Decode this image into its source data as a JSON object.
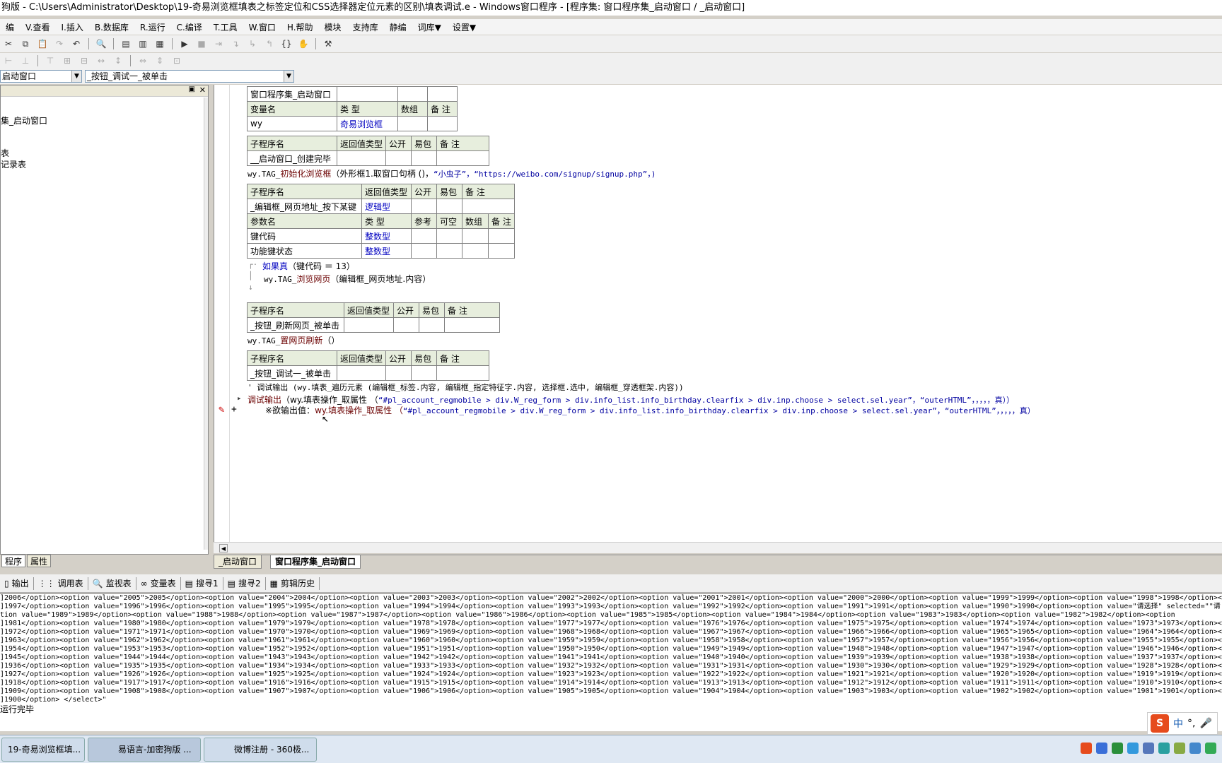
{
  "window": {
    "title": "狗版 - C:\\Users\\Administrator\\Desktop\\19-奇易浏览框填表之标签定位和CSS选择器定位元素的区别\\填表调试.e - Windows窗口程序 - [程序集: 窗口程序集_启动窗口 / _启动窗口]"
  },
  "menu": [
    "编",
    "V.查看",
    "I.插入",
    "B.数据库",
    "R.运行",
    "C.编译",
    "T.工具",
    "W.窗口",
    "H.帮助",
    "模块",
    "支持库",
    "静编",
    "词库▼",
    "设置▼"
  ],
  "selectors": {
    "left": "启动窗口",
    "right": "_按钮_调试一_被单击"
  },
  "tree": {
    "items": [
      "集_启动窗口",
      "",
      "表",
      "记录表"
    ]
  },
  "left_tabs": [
    "程序",
    "属性"
  ],
  "editor_tabs": [
    "_启动窗口",
    "窗口程序集_启动窗口"
  ],
  "code": {
    "t1": {
      "head": [
        "窗口程序集_启动窗口",
        "",
        ""
      ],
      "cols": [
        "变量名",
        "类 型",
        "数组",
        "备 注"
      ],
      "row": [
        "wy",
        "奇易浏览框",
        "",
        ""
      ]
    },
    "t2": {
      "cols": [
        "子程序名",
        "返回值类型",
        "公开",
        "易包",
        "备 注"
      ],
      "row": [
        "__启动窗口_创建完毕",
        "",
        "",
        "",
        ""
      ]
    },
    "line1": {
      "a": "wy.TAG_",
      "b": "初始化浏览框",
      "c": "（外形框1.取窗口句柄 ()，",
      "d": "“小虫子”，“https://weibo.com/signup/signup.php”，)"
    },
    "t3": {
      "cols": [
        "子程序名",
        "返回值类型",
        "公开",
        "易包",
        "备 注"
      ],
      "row": [
        "_编辑框_网页地址_按下某键",
        "逻辑型",
        "",
        "",
        ""
      ],
      "pcols": [
        "参数名",
        "类 型",
        "参考",
        "可空",
        "数组",
        "备 注"
      ],
      "p1": [
        "键代码",
        "整数型",
        "",
        "",
        "",
        ""
      ],
      "p2": [
        "功能键状态",
        "整数型",
        "",
        "",
        "",
        ""
      ]
    },
    "line2": {
      "kw": "如果真",
      "rest": "（键代码 ＝ 13）"
    },
    "line3": {
      "a": "wy.TAG_",
      "b": "浏览网页",
      "c": "（编辑框_网页地址.内容）"
    },
    "t4": {
      "cols": [
        "子程序名",
        "返回值类型",
        "公开",
        "易包",
        "备 注"
      ],
      "row": [
        "_按钮_刷新网页_被单击",
        "",
        "",
        "",
        ""
      ]
    },
    "line4": {
      "a": "wy.TAG_",
      "b": "置网页刷新",
      "c": "（）"
    },
    "t5": {
      "cols": [
        "子程序名",
        "返回值类型",
        "公开",
        "易包",
        "备 注"
      ],
      "row": [
        "_按钮_调试一_被单击",
        "",
        "",
        "",
        ""
      ]
    },
    "line5": "' 调试输出 (wy.填表_遍历元素 (编辑框_标签.内容, 编辑框_指定特征字.内容, 选择框.选中, 编辑框_穿透框架.内容))",
    "line6": {
      "a": "调试输出",
      "b": "（wy.填表操作_取属性 （",
      "c": "“#pl_account_regmobile > div.W_reg_form > div.info_list.info_birthday.clearfix > div.inp.choose > select.sel.year”，“outerHTML”，，，，，真））"
    },
    "line7": {
      "a": "※欲输出值：",
      "b": "wy.填表操作_取属性 （",
      "c": "“#pl_account_regmobile > div.W_reg_form > div.info_list.info_birthday.clearfix > div.inp.choose > select.sel.year”，“outerHTML”，，，，，真）"
    }
  },
  "output_tabs": [
    "输出",
    "调用表",
    "监视表",
    "变量表",
    "搜寻1",
    "搜寻2",
    "剪辑历史"
  ],
  "output_lines": [
    "]2006</option><option value=\"2005\">2005</option><option value=\"2004\">2004</option><option value=\"2003\">2003</option><option value=\"2002\">2002</option><option value=\"2001\">2001</option><option value=\"2000\">2000</option><option value=\"1999\">1999</option><option value=\"1998\">1998</option><o",
    "]1997</option><option value=\"1996\">1996</option><option value=\"1995\">1995</option><option value=\"1994\">1994</option><option value=\"1993\">1993</option><option value=\"1992\">1992</option><option value=\"1991\">1991</option><option value=\"1990\">1990</option><option value=\"请选择\" selected=\"\"请",
    "tion value=\"1989\">1989</option><option value=\"1988\">1988</option><option value=\"1987\">1987</option><option value=\"1986\">1986</option><option value=\"1985\">1985</option><option value=\"1984\">1984</option><option value=\"1983\">1983</option><option value=\"1982\">1982</option><option",
    "]1981</option><option value=\"1980\">1980</option><option value=\"1979\">1979</option><option value=\"1978\">1978</option><option value=\"1977\">1977</option><option value=\"1976\">1976</option><option value=\"1975\">1975</option><option value=\"1974\">1974</option><option value=\"1973\">1973</option><o",
    "]1972</option><option value=\"1971\">1971</option><option value=\"1970\">1970</option><option value=\"1969\">1969</option><option value=\"1968\">1968</option><option value=\"1967\">1967</option><option value=\"1966\">1966</option><option value=\"1965\">1965</option><option value=\"1964\">1964</option><o",
    "]1963</option><option value=\"1962\">1962</option><option value=\"1961\">1961</option><option value=\"1960\">1960</option><option value=\"1959\">1959</option><option value=\"1958\">1958</option><option value=\"1957\">1957</option><option value=\"1956\">1956</option><option value=\"1955\">1955</option><o",
    "]1954</option><option value=\"1953\">1953</option><option value=\"1952\">1952</option><option value=\"1951\">1951</option><option value=\"1950\">1950</option><option value=\"1949\">1949</option><option value=\"1948\">1948</option><option value=\"1947\">1947</option><option value=\"1946\">1946</option><o",
    "]1945</option><option value=\"1944\">1944</option><option value=\"1943\">1943</option><option value=\"1942\">1942</option><option value=\"1941\">1941</option><option value=\"1940\">1940</option><option value=\"1939\">1939</option><option value=\"1938\">1938</option><option value=\"1937\">1937</option><o",
    "]1936</option><option value=\"1935\">1935</option><option value=\"1934\">1934</option><option value=\"1933\">1933</option><option value=\"1932\">1932</option><option value=\"1931\">1931</option><option value=\"1930\">1930</option><option value=\"1929\">1929</option><option value=\"1928\">1928</option><o",
    "]1927</option><option value=\"1926\">1926</option><option value=\"1925\">1925</option><option value=\"1924\">1924</option><option value=\"1923\">1923</option><option value=\"1922\">1922</option><option value=\"1921\">1921</option><option value=\"1920\">1920</option><option value=\"1919\">1919</option><o",
    "]1918</option><option value=\"1917\">1917</option><option value=\"1916\">1916</option><option value=\"1915\">1915</option><option value=\"1914\">1914</option><option value=\"1913\">1913</option><option value=\"1912\">1912</option><option value=\"1911\">1911</option><option value=\"1910\">1910</option><o",
    "]1909</option><option value=\"1908\">1908</option><option value=\"1907\">1907</option><option value=\"1906\">1906</option><option value=\"1905\">1905</option><option value=\"1904\">1904</option><option value=\"1903\">1903</option><option value=\"1902\">1902</option><option value=\"1901\">1901</option><o",
    "]1900</option>                    </select>\""
  ],
  "output_done": "运行完毕",
  "taskbar": [
    "19-奇易浏览框填...",
    "易语言-加密狗版 ...",
    "微博注册 - 360极..."
  ],
  "ime": {
    "lang": "中",
    "punct": "°,"
  }
}
